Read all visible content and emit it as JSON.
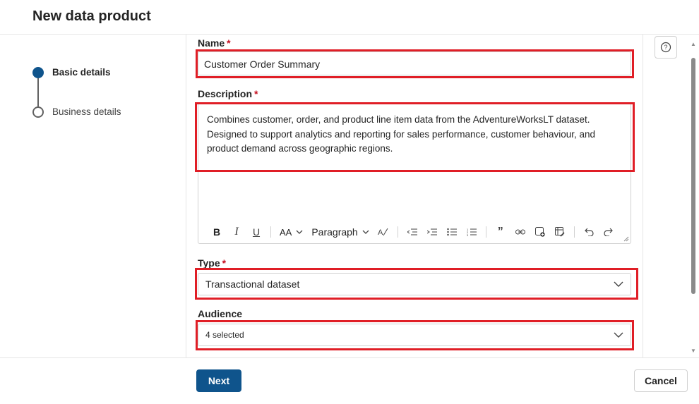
{
  "header": {
    "title": "New data product"
  },
  "stepper": {
    "steps": [
      {
        "label": "Basic details",
        "state": "active"
      },
      {
        "label": "Business details",
        "state": "pending"
      }
    ]
  },
  "form": {
    "name": {
      "label": "Name",
      "required_mark": "*",
      "value": "Customer Order Summary"
    },
    "description": {
      "label": "Description",
      "required_mark": "*",
      "value": "Combines customer, order, and product line item data from the AdventureWorksLT dataset. Designed to support analytics and reporting for sales performance, customer behaviour, and product demand across geographic regions.",
      "toolbar": {
        "bold": "B",
        "italic": "I",
        "underline": "U",
        "font_size": "AA",
        "paragraph": "Paragraph",
        "icons": [
          "bold-icon",
          "italic-icon",
          "underline-icon",
          "font-size-icon",
          "paragraph-style",
          "clear-format-icon",
          "outdent-icon",
          "indent-icon",
          "bullet-list-icon",
          "numbered-list-icon",
          "quote-icon",
          "link-icon",
          "insert-image-icon",
          "insert-table-icon",
          "undo-icon",
          "redo-icon"
        ]
      }
    },
    "type": {
      "label": "Type",
      "required_mark": "*",
      "value": "Transactional dataset"
    },
    "audience": {
      "label": "Audience",
      "value": "4 selected"
    }
  },
  "footer": {
    "next_label": "Next",
    "cancel_label": "Cancel"
  },
  "colors": {
    "accent": "#0f548c",
    "highlight": "#e01e26",
    "required": "#c50f1f"
  }
}
